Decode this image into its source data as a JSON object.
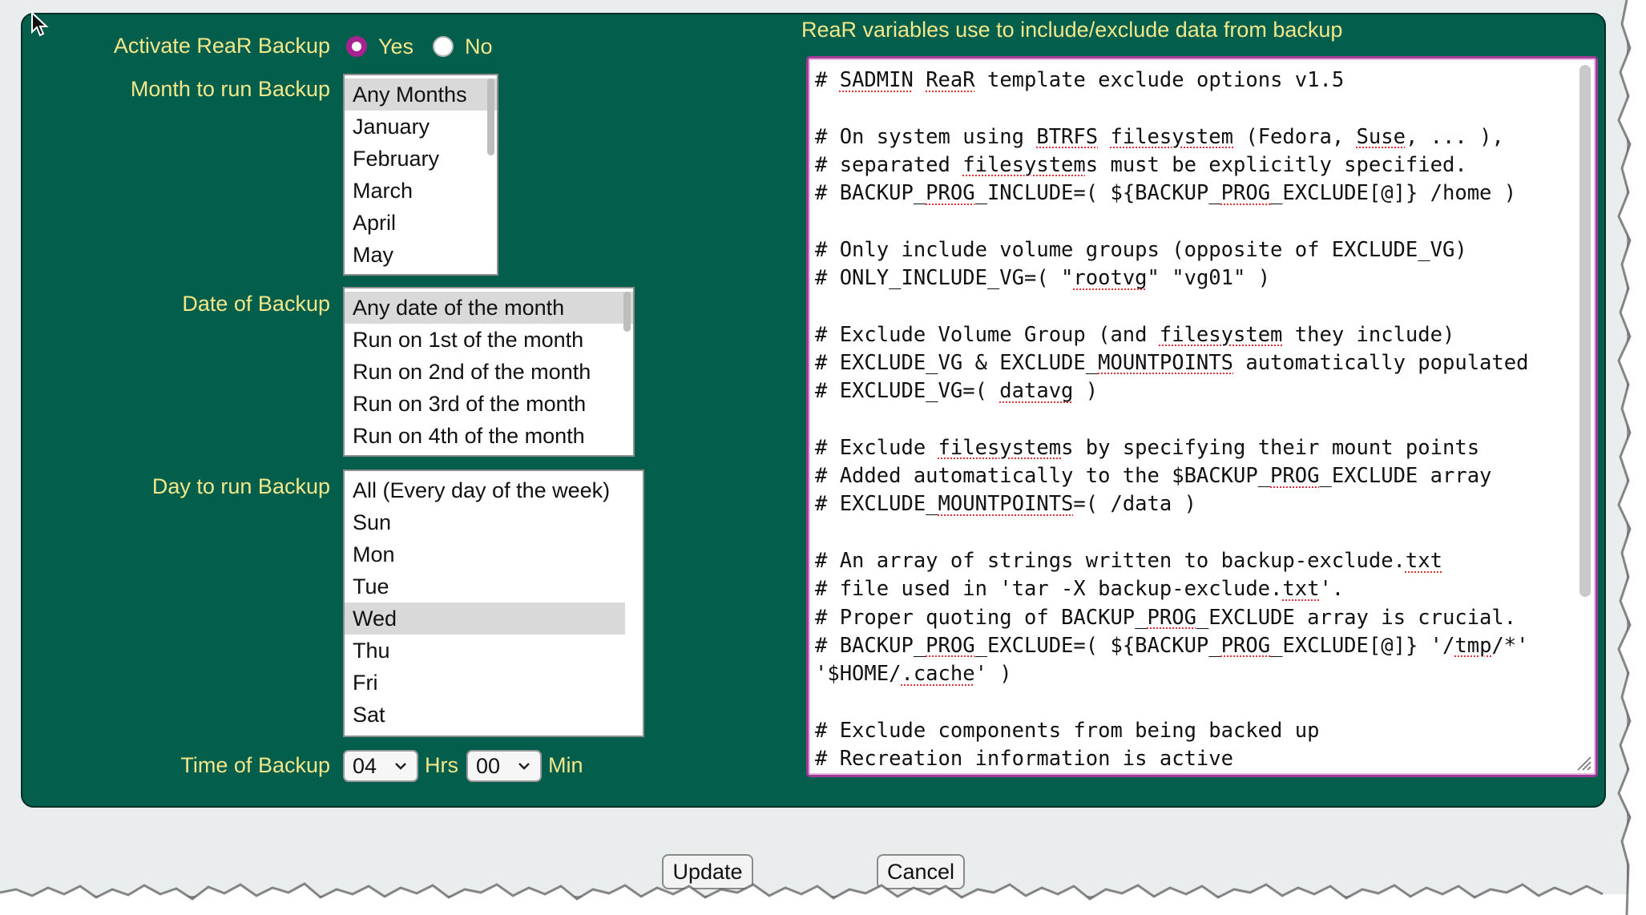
{
  "form": {
    "activate_label": "Activate ReaR Backup",
    "activate_options": [
      "Yes",
      "No"
    ],
    "activate_selected": "Yes",
    "month_label": "Month to run Backup",
    "month_options": [
      "Any Months",
      "January",
      "February",
      "March",
      "April",
      "May"
    ],
    "month_selected": "Any Months",
    "date_label": "Date of Backup",
    "date_options": [
      "Any date of the month",
      "Run on 1st of the month",
      "Run on 2nd of the month",
      "Run on 3rd of the month",
      "Run on 4th of the month"
    ],
    "date_selected": "Any date of the month",
    "day_label": "Day to run Backup",
    "day_options": [
      "All (Every day of the week)",
      "Sun",
      "Mon",
      "Tue",
      "Wed",
      "Thu",
      "Fri",
      "Sat"
    ],
    "day_selected": "Wed",
    "time_label": "Time of Backup",
    "hours_value": "04",
    "hours_unit": "Hrs",
    "minutes_value": "00",
    "minutes_unit": "Min"
  },
  "variables": {
    "title": "ReaR variables use to include/exclude data from backup",
    "lines": [
      "# SADMIN ReaR template exclude options v1.5",
      "",
      "# On system using BTRFS filesystem (Fedora, Suse, ... ),",
      "# separated filesystems must be explicitly specified.",
      "# BACKUP_PROG_INCLUDE=( ${BACKUP_PROG_EXCLUDE[@]} /home )",
      "",
      "# Only include volume groups (opposite of EXCLUDE_VG)",
      "# ONLY_INCLUDE_VG=( \"rootvg\" \"vg01\" )",
      "",
      "# Exclude Volume Group (and filesystem they include)",
      "# EXCLUDE_VG & EXCLUDE_MOUNTPOINTS automatically populated",
      "# EXCLUDE_VG=( datavg )",
      "",
      "# Exclude filesystems by specifying their mount points",
      "# Added automatically to the $BACKUP_PROG_EXCLUDE array",
      "# EXCLUDE_MOUNTPOINTS=( /data )",
      "",
      "# An array of strings written to backup-exclude.txt",
      "# file used in 'tar -X backup-exclude.txt'.",
      "# Proper quoting of BACKUP_PROG_EXCLUDE array is crucial.",
      "# BACKUP_PROG_EXCLUDE=( ${BACKUP_PROG_EXCLUDE[@]} '/tmp/*'",
      "'$HOME/.cache' )",
      "",
      "# Exclude components from being backed up",
      "# Recreation information is active"
    ]
  },
  "actions": {
    "update_label": "Update",
    "cancel_label": "Cancel"
  },
  "colors": {
    "panel_bg": "#035e4c",
    "label_text": "#f2e78a",
    "radio_accent": "#a8238f",
    "textarea_focus": "#a33b99"
  }
}
